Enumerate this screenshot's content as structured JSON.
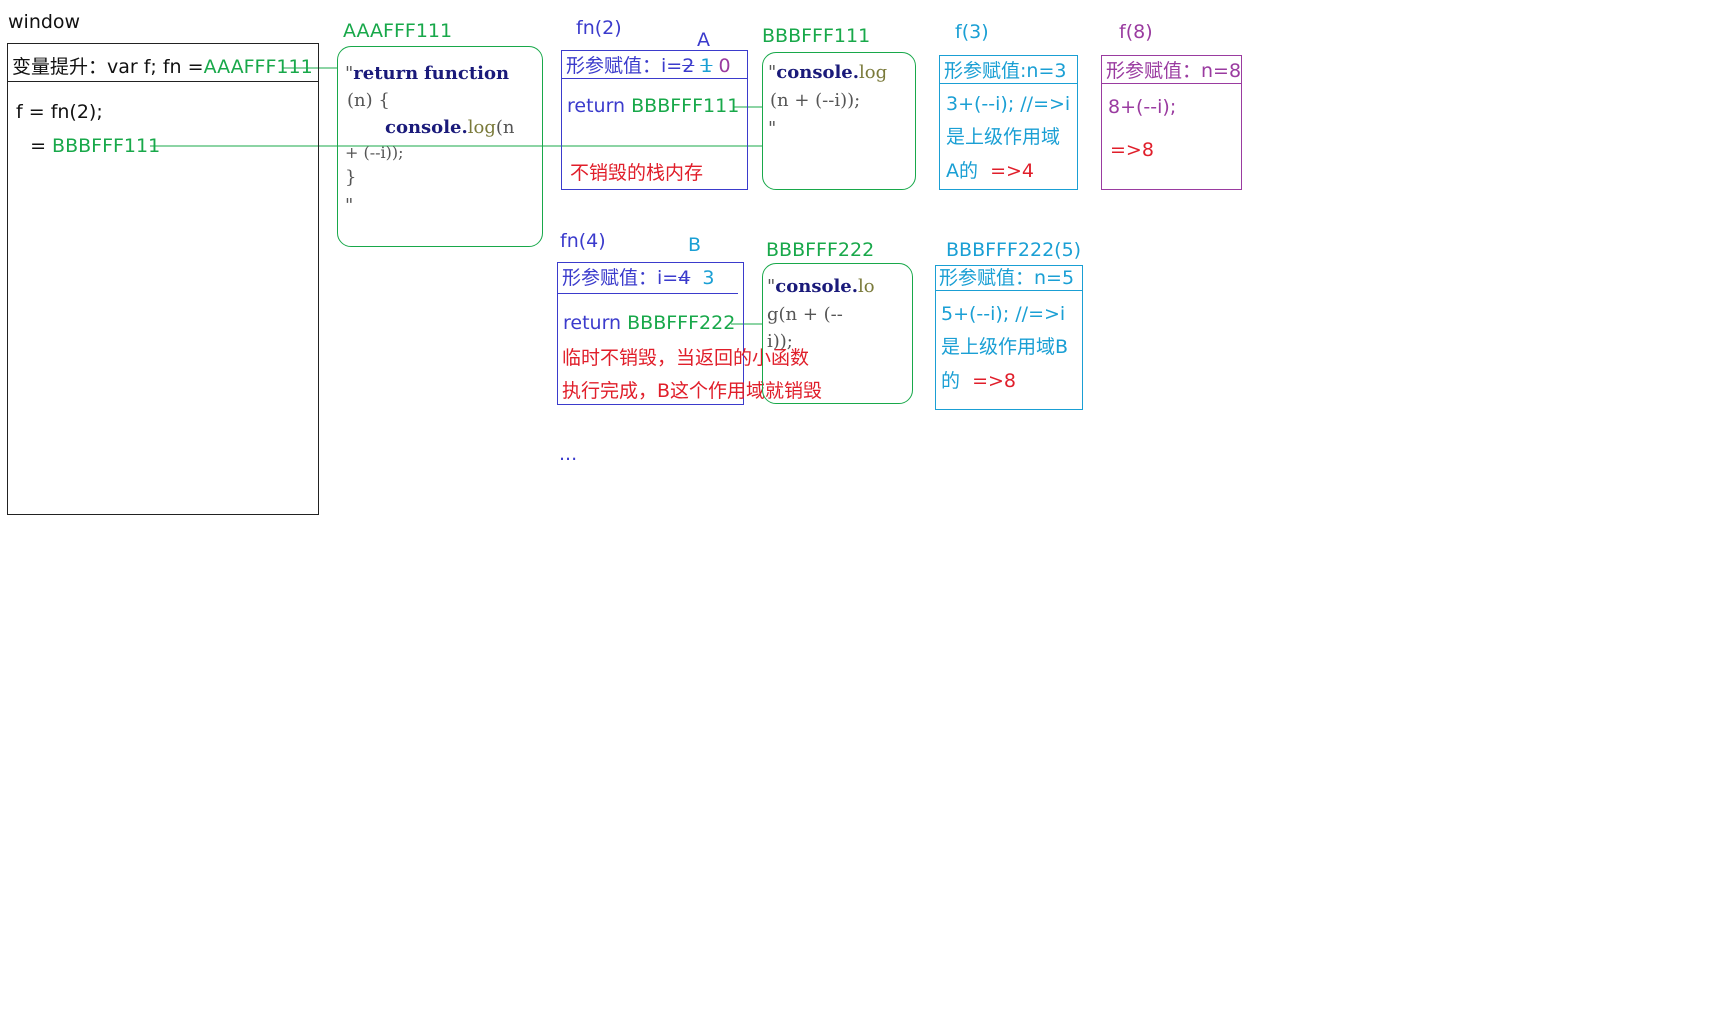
{
  "window": {
    "title": "window",
    "hoist_prefix": "变量提升：var f;  fn =",
    "hoist_value": "AAAFFF111",
    "stmt": "f = fn(2);",
    "assign_prefix": "  = ",
    "assign_value": "BBBFFF111"
  },
  "heap_aaa": {
    "label": "AAAFFF111",
    "q1": "\"",
    "kw_return": "return",
    "kw_function": "function",
    "arg": "(n)  {",
    "console": "console.",
    "log": "log",
    "log_arg": "(n",
    "line3": "+  (--i));",
    "close": "}",
    "q2": "\""
  },
  "fn2": {
    "label": "fn(2)",
    "tag": "A",
    "param_prefix": "形参赋值：i=",
    "param_val": "2",
    "param_new1": "1",
    "param_new2": "0",
    "ret_prefix": "return ",
    "ret_value": "BBBFFF111",
    "note": "不销毁的栈内存"
  },
  "heap_b111": {
    "label": "BBBFFF111",
    "q1": "\"",
    "console": "console.",
    "log": "log",
    "line2": "(n  +  (--i));",
    "q2": "\""
  },
  "f3": {
    "label": "f(3)",
    "param": "形参赋值:n=3",
    "line1": "3+(--i);  //=>i",
    "line2": "是上级作用域",
    "line3_prefix": "A的  ",
    "line3_result": "=>4"
  },
  "f8": {
    "label": "f(8)",
    "param": "形参赋值：n=8",
    "line1": "8+(--i);",
    "result": "=>8"
  },
  "fn4": {
    "label": "fn(4)",
    "tag": "B",
    "param_prefix": "形参赋值：i=",
    "param_val": "4",
    "param_new": "3",
    "ret_prefix": "return ",
    "ret_value": "BBBFFF222",
    "note1": "临时不销毁，当返回的小函数",
    "note2": "执行完成，B这个作用域就销毁",
    "ellipsis": "..."
  },
  "heap_b222": {
    "label": "BBBFFF222",
    "q1": "\"",
    "console": "console.",
    "lo": "lo",
    "line2": "g(n  +  (--",
    "line3": "i));"
  },
  "b222_5": {
    "label": "BBBFFF222(5)",
    "param": "形参赋值：n=5",
    "line1": "5+(--i);  //=>i",
    "line2": "是上级作用域B",
    "line3_prefix": "的  ",
    "line3_result": "=>8"
  },
  "colors": {
    "green": "#18a84a",
    "blue": "#3b3bcc",
    "purple": "#9a3ba0",
    "cyan": "#1a9fd4",
    "red": "#e01e2a"
  }
}
